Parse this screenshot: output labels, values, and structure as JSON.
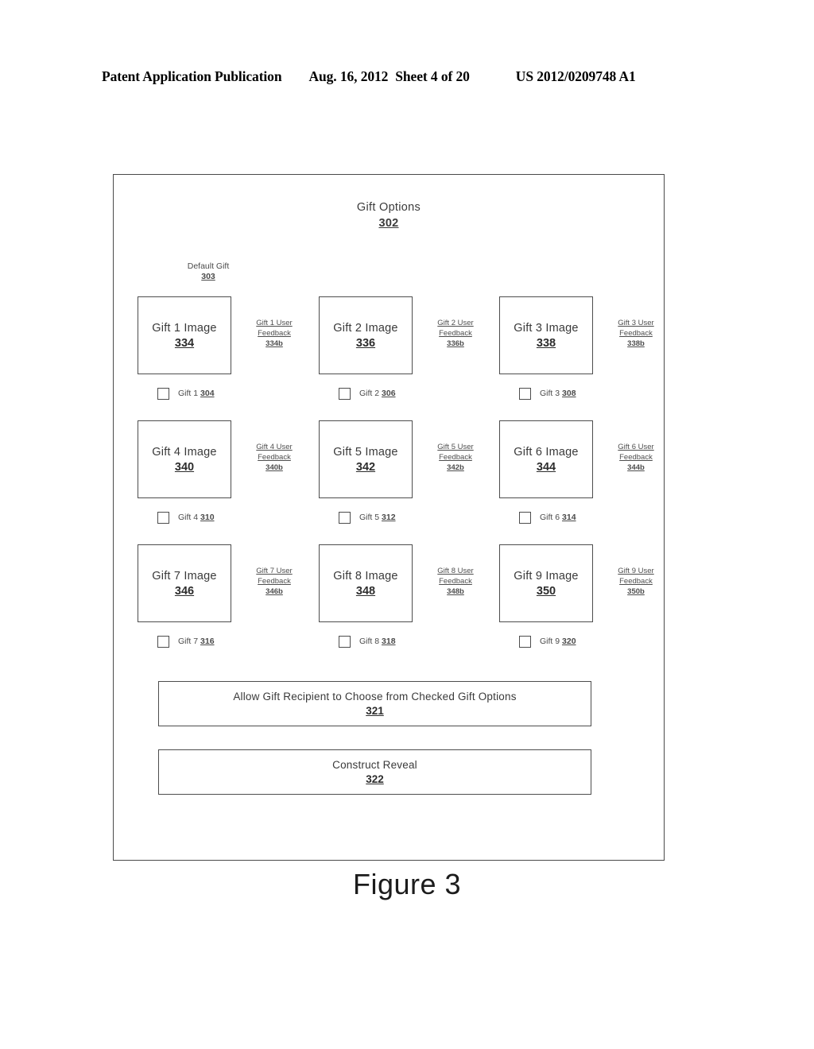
{
  "header": {
    "publication": "Patent Application Publication",
    "date": "Aug. 16, 2012",
    "sheet": "Sheet 4 of 20",
    "number": "US 2012/0209748 A1"
  },
  "figure": {
    "caption": "Figure 3",
    "title": "Gift Options",
    "title_ref": "302",
    "default_gift_label": "Default Gift",
    "default_gift_ref": "303"
  },
  "gifts": [
    {
      "image_label": "Gift 1 Image",
      "image_ref": "334",
      "feedback_line1": "Gift 1 User",
      "feedback_line2": "Feedback",
      "feedback_ref": "334b",
      "check_label": "Gift 1",
      "check_ref": "304",
      "checked": false
    },
    {
      "image_label": "Gift 2 Image",
      "image_ref": "336",
      "feedback_line1": "Gift 2 User",
      "feedback_line2": "Feedback",
      "feedback_ref": "336b",
      "check_label": "Gift 2",
      "check_ref": "306",
      "checked": false
    },
    {
      "image_label": "Gift 3 Image",
      "image_ref": "338",
      "feedback_line1": "Gift 3 User",
      "feedback_line2": "Feedback",
      "feedback_ref": "338b",
      "check_label": "Gift 3",
      "check_ref": "308",
      "checked": false
    },
    {
      "image_label": "Gift 4 Image",
      "image_ref": "340",
      "feedback_line1": "Gift 4 User",
      "feedback_line2": "Feedback",
      "feedback_ref": "340b",
      "check_label": "Gift 4",
      "check_ref": "310",
      "checked": false
    },
    {
      "image_label": "Gift 5 Image",
      "image_ref": "342",
      "feedback_line1": "Gift 5 User",
      "feedback_line2": "Feedback",
      "feedback_ref": "342b",
      "check_label": "Gift 5",
      "check_ref": "312",
      "checked": false
    },
    {
      "image_label": "Gift 6 Image",
      "image_ref": "344",
      "feedback_line1": "Gift 6 User",
      "feedback_line2": "Feedback",
      "feedback_ref": "344b",
      "check_label": "Gift 6",
      "check_ref": "314",
      "checked": false
    },
    {
      "image_label": "Gift 7 Image",
      "image_ref": "346",
      "feedback_line1": "Gift 7 User",
      "feedback_line2": "Feedback",
      "feedback_ref": "346b",
      "check_label": "Gift 7",
      "check_ref": "316",
      "checked": false
    },
    {
      "image_label": "Gift 8 Image",
      "image_ref": "348",
      "feedback_line1": "Gift 8 User",
      "feedback_line2": "Feedback",
      "feedback_ref": "348b",
      "check_label": "Gift 8",
      "check_ref": "318",
      "checked": false
    },
    {
      "image_label": "Gift 9 Image",
      "image_ref": "350",
      "feedback_line1": "Gift 9 User",
      "feedback_line2": "Feedback",
      "feedback_ref": "350b",
      "check_label": "Gift 9",
      "check_ref": "320",
      "checked": false
    }
  ],
  "actions": [
    {
      "label": "Allow Gift Recipient to Choose from Checked Gift Options",
      "ref": "321"
    },
    {
      "label": "Construct Reveal",
      "ref": "322"
    }
  ]
}
